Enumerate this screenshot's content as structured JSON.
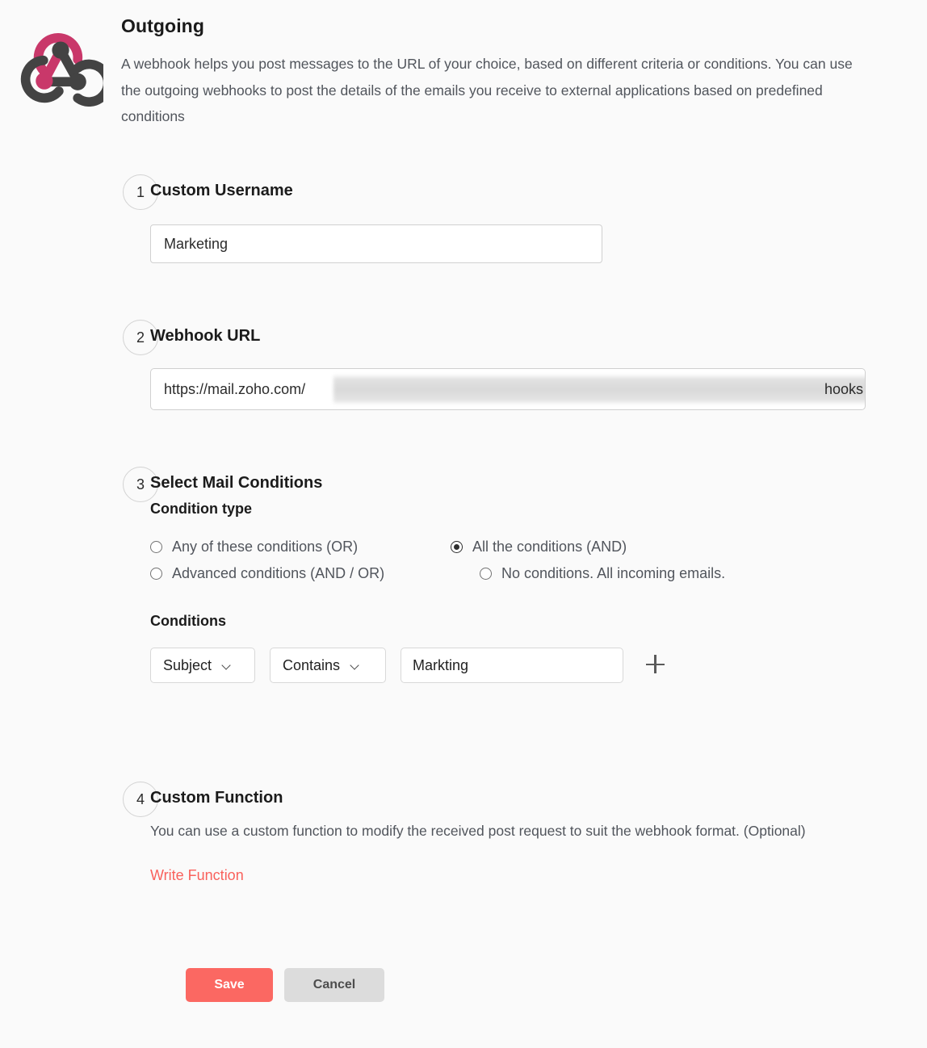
{
  "header": {
    "icon": "webhook-logo-icon",
    "title": "Outgoing",
    "description": "A webhook helps you post messages to the URL of your choice, based on different criteria or conditions. You can use the outgoing webhooks to post the details of the emails you receive to external applications based on predefined conditions"
  },
  "steps": {
    "username": {
      "number": "1",
      "title": "Custom Username",
      "value": "Marketing",
      "placeholder": "Custom Username"
    },
    "webhook_url": {
      "number": "2",
      "title": "Webhook URL",
      "value_visible_prefix": "https://mail.zoho.com/",
      "value_visible_suffix": "hooks",
      "redacted": true
    },
    "conditions": {
      "number": "3",
      "title": "Select Mail Conditions",
      "condition_type_label": "Condition type",
      "options": [
        {
          "label": "Any of these conditions (OR)",
          "selected": false
        },
        {
          "label": "All the conditions (AND)",
          "selected": true
        },
        {
          "label": "Advanced conditions (AND / OR)",
          "selected": false
        },
        {
          "label": "No conditions. All incoming emails.",
          "selected": false
        }
      ],
      "conditions_label": "Conditions",
      "row": {
        "field": "Subject",
        "operator": "Contains",
        "value": "Markting",
        "value_placeholder": "",
        "add_icon": "plus-icon"
      }
    },
    "custom_function": {
      "number": "4",
      "title": "Custom Function",
      "description": "You can use a custom function to modify the received post request to suit the webhook format. (Optional)",
      "link_label": "Write Function"
    }
  },
  "footer": {
    "save_label": "Save",
    "cancel_label": "Cancel"
  },
  "colors": {
    "accent": "#fb6862",
    "link": "#f9615c",
    "logo_pink": "#c9386a",
    "logo_dark": "#434343",
    "background": "#fafafa",
    "cancel_bg": "#dcdcdc"
  }
}
